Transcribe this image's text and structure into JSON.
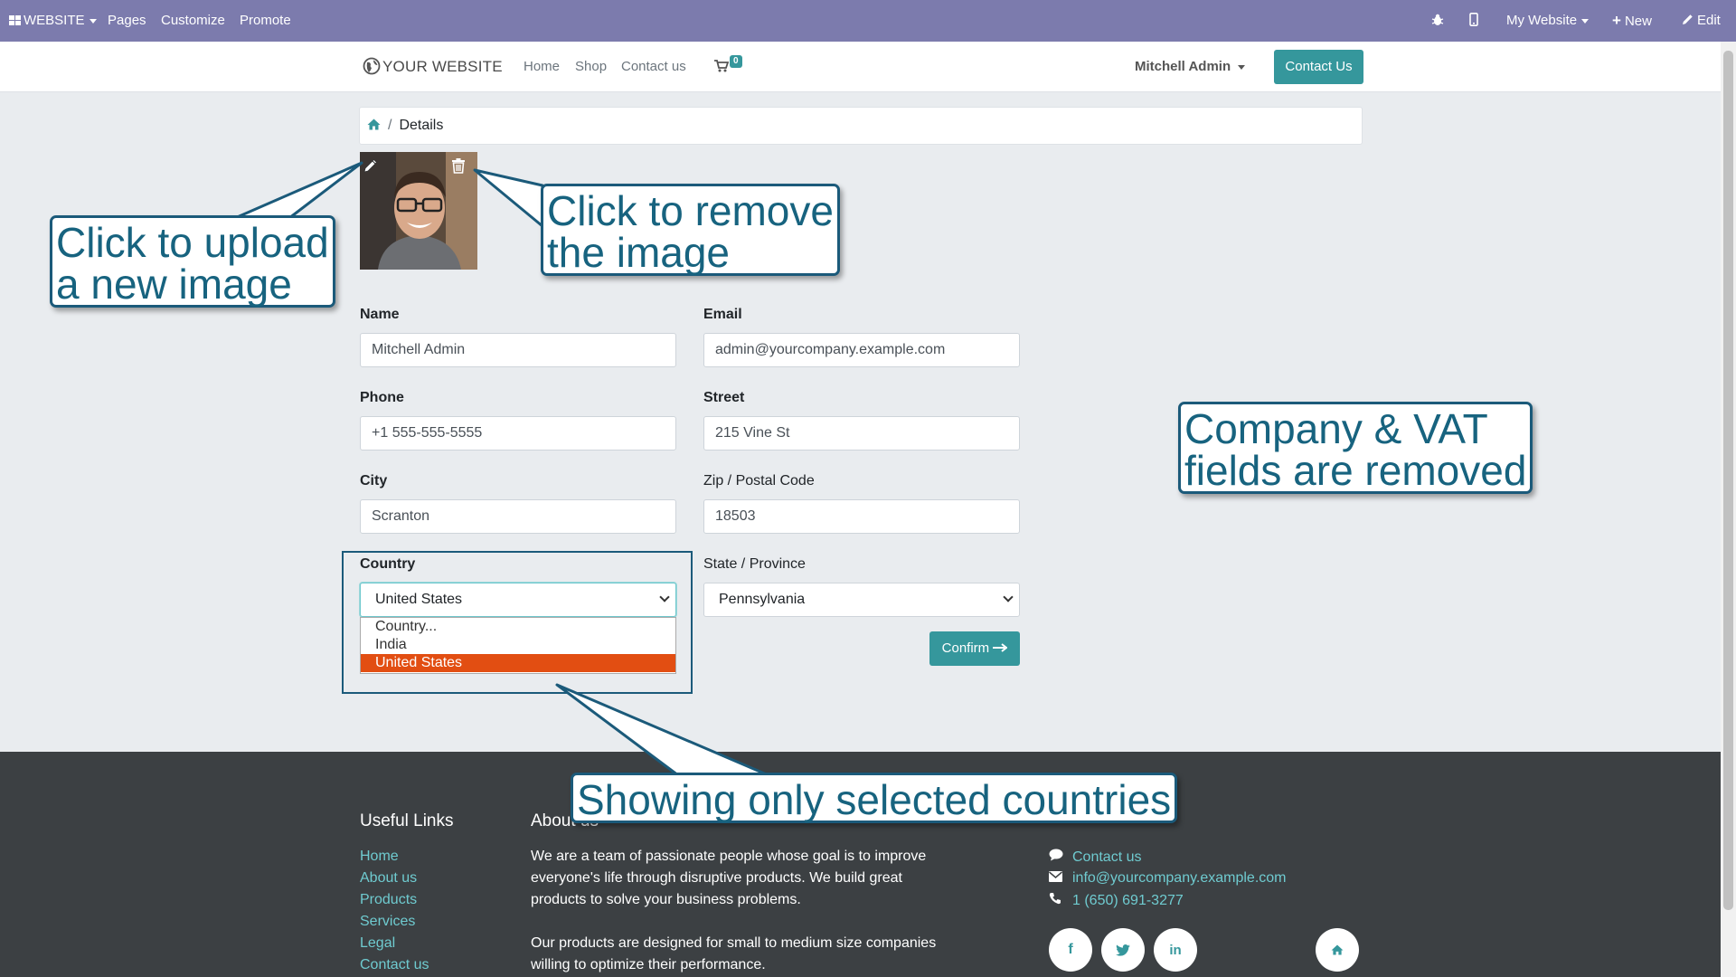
{
  "admin_bar": {
    "app": "WEBSITE",
    "pages": "Pages",
    "customize": "Customize",
    "promote": "Promote",
    "website_switch": "My Website",
    "new": "New",
    "edit": "Edit"
  },
  "navbar": {
    "logo": "YOUR WEBSITE",
    "links": [
      "Home",
      "Shop",
      "Contact us"
    ],
    "cart_count": "0",
    "user": "Mitchell Admin",
    "contact_button": "Contact Us"
  },
  "breadcrumb": {
    "current": "Details"
  },
  "form": {
    "name": {
      "label": "Name",
      "value": "Mitchell Admin"
    },
    "email": {
      "label": "Email",
      "value": "admin@yourcompany.example.com"
    },
    "phone": {
      "label": "Phone",
      "value": "+1 555-555-5555"
    },
    "street": {
      "label": "Street",
      "value": "215 Vine St"
    },
    "city": {
      "label": "City",
      "value": "Scranton"
    },
    "zip": {
      "label": "Zip / Postal Code",
      "value": "18503"
    },
    "country": {
      "label": "Country",
      "value": "United States",
      "options": [
        "Country...",
        "India",
        "United States"
      ]
    },
    "state": {
      "label": "State / Province",
      "value": "Pennsylvania"
    },
    "confirm": "Confirm"
  },
  "callouts": {
    "upload": [
      "Click to upload",
      "a new image"
    ],
    "remove": [
      "Click to remove",
      "the image"
    ],
    "company_vat": [
      "Company & VAT",
      "fields are removed"
    ],
    "countries": "Showing only selected countries"
  },
  "footer": {
    "useful_links_title": "Useful Links",
    "useful_links": [
      "Home",
      "About us",
      "Products",
      "Services",
      "Legal",
      "Contact us"
    ],
    "about_title": "About us",
    "about_p1": "We are a team of passionate people whose goal is to improve everyone's life through disruptive products. We build great products to solve your business problems.",
    "about_p2": "Our products are designed for small to medium size companies willing to optimize their performance.",
    "contact_us": "Contact us",
    "email": "info@yourcompany.example.com",
    "phone": "1 (650) 691-3277",
    "social": [
      "facebook-icon",
      "twitter-icon",
      "linkedin-icon",
      "home-icon"
    ]
  },
  "colors": {
    "admin_bar": "#7c7bad",
    "primary": "#35979c",
    "selected_option": "#e24e12",
    "callout_text": "#17637f",
    "footer_bg": "#3c4043"
  }
}
